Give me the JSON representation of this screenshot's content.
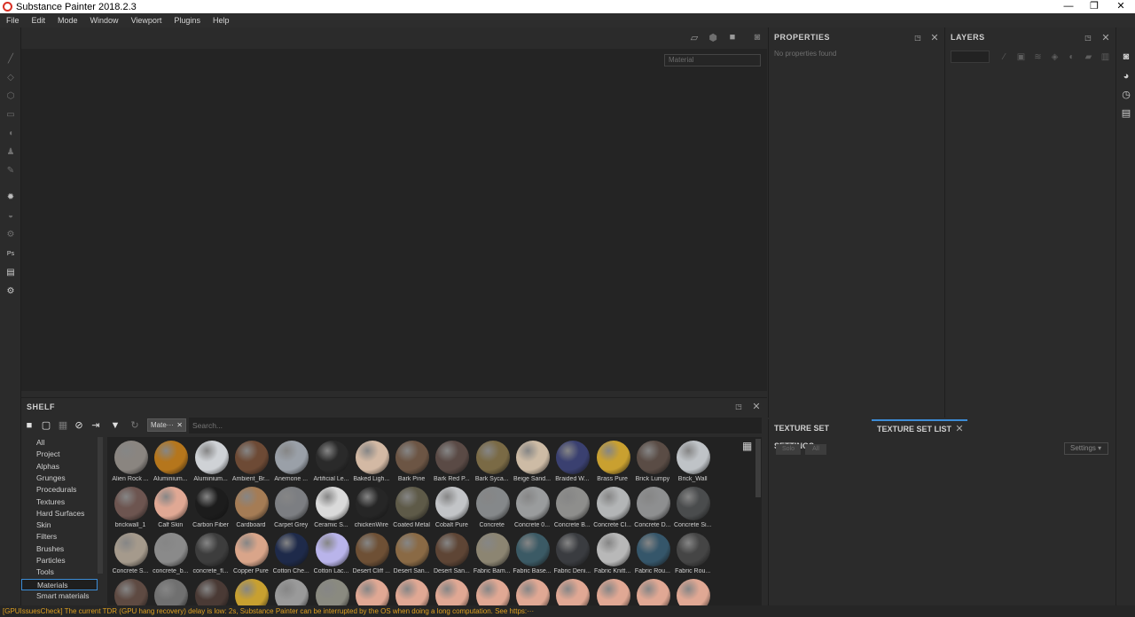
{
  "window": {
    "title": "Substance Painter 2018.2.3",
    "minimize": "—",
    "restore": "❐",
    "close": "✕"
  },
  "menu": [
    "File",
    "Edit",
    "Mode",
    "Window",
    "Viewport",
    "Plugins",
    "Help"
  ],
  "viewport": {
    "material_dropdown": "Material"
  },
  "properties": {
    "title": "PROPERTIES",
    "empty_text": "No properties found"
  },
  "layers": {
    "title": "LAYERS"
  },
  "shelf": {
    "title": "SHELF",
    "filter_tag": "Mate···",
    "search_placeholder": "Search...",
    "categories": [
      "All",
      "Project",
      "Alphas",
      "Grunges",
      "Procedurals",
      "Textures",
      "Hard Surfaces",
      "Skin",
      "Filters",
      "Brushes",
      "Particles",
      "Tools",
      "Materials",
      "Smart materials"
    ],
    "selected_category": "Materials",
    "materials": [
      {
        "label": "Alien Rock ...",
        "color": "#8a8580"
      },
      {
        "label": "Aluminium...",
        "color": "#b5761c"
      },
      {
        "label": "Aluminium...",
        "color": "#cfd2d6"
      },
      {
        "label": "Ambient_Br...",
        "color": "#6d4a35"
      },
      {
        "label": "Anemone ...",
        "color": "#9aa0a8"
      },
      {
        "label": "Artificial Le...",
        "color": "#2a2a2a"
      },
      {
        "label": "Baked Ligh...",
        "color": "#d3b9a4"
      },
      {
        "label": "Bark Pine",
        "color": "#6c5544"
      },
      {
        "label": "Bark Red P...",
        "color": "#5a4a45"
      },
      {
        "label": "Bark Syca...",
        "color": "#7a6a45"
      },
      {
        "label": "Beige Sand...",
        "color": "#cdbba5"
      },
      {
        "label": "Braided W...",
        "color": "#3a4070"
      },
      {
        "label": "Brass Pure",
        "color": "#c9a030"
      },
      {
        "label": "Brick Lumpy",
        "color": "#5a4c45"
      },
      {
        "label": "Brick_Wall",
        "color": "#bfc3c7"
      },
      {
        "label": "brickwall_1",
        "color": "#6d5550"
      },
      {
        "label": "Calf Skin",
        "color": "#e0a894"
      },
      {
        "label": "Carbon Fiber",
        "color": "#1c1c1c"
      },
      {
        "label": "Cardboard",
        "color": "#a57c55"
      },
      {
        "label": "Carpet Grey",
        "color": "#7c7e82"
      },
      {
        "label": "Ceramic S...",
        "color": "#dadada"
      },
      {
        "label": "chickenWire",
        "color": "#262626"
      },
      {
        "label": "Coated Metal",
        "color": "#5e5a48"
      },
      {
        "label": "Cobalt Pure",
        "color": "#c2c4c7"
      },
      {
        "label": "Concrete",
        "color": "#85888a"
      },
      {
        "label": "Concrete 0...",
        "color": "#9a9c9d"
      },
      {
        "label": "Concrete B...",
        "color": "#8e8e8c"
      },
      {
        "label": "Concrete Cl...",
        "color": "#b3b5b6"
      },
      {
        "label": "Concrete D...",
        "color": "#8e8f90"
      },
      {
        "label": "Concrete Si...",
        "color": "#4a4c4d"
      },
      {
        "label": "Concrete S...",
        "color": "#a59a8c"
      },
      {
        "label": "concrete_b...",
        "color": "#8a8a8a"
      },
      {
        "label": "concrete_fl...",
        "color": "#3d3d3d"
      },
      {
        "label": "Copper Pure",
        "color": "#d9a58a"
      },
      {
        "label": "Cotton Che...",
        "color": "#1e2a4a"
      },
      {
        "label": "Cotton Lac...",
        "color": "#b9b4ea"
      },
      {
        "label": "Desert Cliff ...",
        "color": "#6e5035"
      },
      {
        "label": "Desert San...",
        "color": "#8a6a45"
      },
      {
        "label": "Desert San...",
        "color": "#5e4535"
      },
      {
        "label": "Fabric Bam...",
        "color": "#8c8572"
      },
      {
        "label": "Fabric Base...",
        "color": "#3b5a65"
      },
      {
        "label": "Fabric Deni...",
        "color": "#3a3c40"
      },
      {
        "label": "Fabric Knitt...",
        "color": "#b8b8b8"
      },
      {
        "label": "Fabric Rou...",
        "color": "#35566a"
      },
      {
        "label": "Fabric Rou...",
        "color": "#454545"
      },
      {
        "label": "",
        "color": "#5e4a42"
      },
      {
        "label": "",
        "color": "#707070"
      },
      {
        "label": "",
        "color": "#4a3a35"
      },
      {
        "label": "",
        "color": "#c8a030"
      },
      {
        "label": "",
        "color": "#9a9a9a"
      },
      {
        "label": "",
        "color": "#8a8a80"
      },
      {
        "label": "",
        "color": "#e0a894"
      },
      {
        "label": "",
        "color": "#e0a894"
      },
      {
        "label": "",
        "color": "#e0a894"
      },
      {
        "label": "",
        "color": "#e0a894"
      },
      {
        "label": "",
        "color": "#e0a894"
      },
      {
        "label": "",
        "color": "#e0a894"
      },
      {
        "label": "",
        "color": "#e0a894"
      },
      {
        "label": "",
        "color": "#e0a894"
      },
      {
        "label": "",
        "color": "#e0a894"
      }
    ]
  },
  "texture_set": {
    "tab_settings": "TEXTURE SET SETTINGS",
    "tab_list": "TEXTURE SET LIST",
    "solo": "Solo",
    "all": "All",
    "settings": "Settings"
  },
  "status": "[GPUIssuesCheck] The current TDR (GPU hang recovery) delay is low: 2s, Substance Painter can be interrupted by the OS when doing a long computation. See https:···"
}
